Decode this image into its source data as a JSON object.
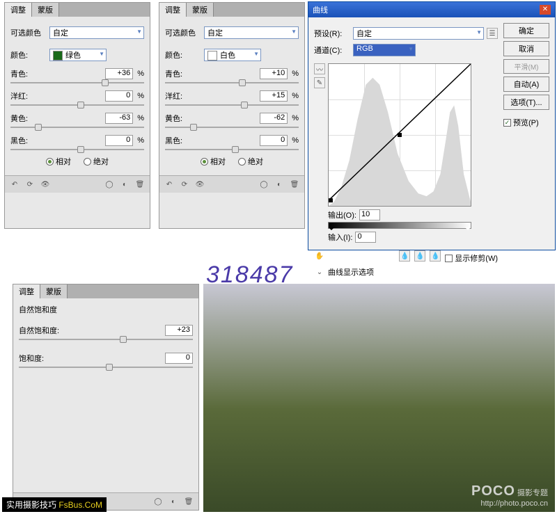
{
  "panelA": {
    "tabs": [
      "调整",
      "蒙版"
    ],
    "title": "可选颜色",
    "preset": "自定",
    "colorLabel": "颜色:",
    "colorName": "绿色",
    "swatch": "#1a6a1a",
    "sliders": [
      {
        "label": "青色:",
        "value": "+36",
        "knob": 68
      },
      {
        "label": "洋红:",
        "value": "0",
        "knob": 50
      },
      {
        "label": "黄色:",
        "value": "-63",
        "knob": 18
      },
      {
        "label": "黑色:",
        "value": "0",
        "knob": 50
      }
    ],
    "radio": {
      "relative": "相对",
      "absolute": "绝对"
    }
  },
  "panelB": {
    "tabs": [
      "调整",
      "蒙版"
    ],
    "title": "可选颜色",
    "preset": "自定",
    "colorLabel": "颜色:",
    "colorName": "白色",
    "swatch": "#ffffff",
    "sliders": [
      {
        "label": "青色:",
        "value": "+10",
        "knob": 55
      },
      {
        "label": "洋红:",
        "value": "+15",
        "knob": 57
      },
      {
        "label": "黄色:",
        "value": "-62",
        "knob": 19
      },
      {
        "label": "黑色:",
        "value": "0",
        "knob": 50
      }
    ],
    "radio": {
      "relative": "相对",
      "absolute": "绝对"
    }
  },
  "panelC": {
    "tabs": [
      "调整",
      "蒙版"
    ],
    "title": "自然饱和度",
    "sliders": [
      {
        "label": "自然饱和度:",
        "value": "+23",
        "knob": 58
      },
      {
        "label": "饱和度:",
        "value": "0",
        "knob": 50
      }
    ]
  },
  "curves": {
    "title": "曲线",
    "presetLabel": "预设(R):",
    "preset": "自定",
    "channelLabel": "通道(C):",
    "channel": "RGB",
    "outputLabel": "输出(O):",
    "output": "10",
    "inputLabel": "输入(I):",
    "input": "0",
    "showClip": "显示修剪(W)",
    "displayOptions": "曲线显示选项",
    "buttons": {
      "ok": "确定",
      "cancel": "取消",
      "smooth": "平滑(M)",
      "auto": "自动(A)",
      "options": "选项(T)...",
      "preview": "预览(P)"
    }
  },
  "chart_data": {
    "type": "line",
    "title": "曲线",
    "xlabel": "输入",
    "ylabel": "输出",
    "xlim": [
      0,
      255
    ],
    "ylim": [
      0,
      255
    ],
    "series": [
      {
        "name": "RGB",
        "x": [
          0,
          128,
          255
        ],
        "y": [
          10,
          128,
          255
        ]
      }
    ],
    "histogram": [
      0,
      0,
      0,
      2,
      5,
      8,
      14,
      22,
      35,
      55,
      80,
      110,
      140,
      160,
      170,
      175,
      172,
      160,
      140,
      115,
      90,
      68,
      50,
      38,
      28,
      22,
      18,
      15,
      12,
      10,
      9,
      8,
      8,
      9,
      10,
      12,
      15,
      20,
      30,
      45,
      65,
      90,
      115,
      130,
      135,
      130,
      118,
      100,
      78,
      55,
      35,
      20,
      10,
      5,
      2,
      0
    ]
  },
  "watermarkNum": "318487",
  "poco": {
    "brand": "POCO",
    "sub": "摄影专题",
    "url": "http://photo.poco.cn"
  },
  "bl": {
    "text1": "实用摄影技巧 ",
    "text2": "FsBus.CoM"
  }
}
